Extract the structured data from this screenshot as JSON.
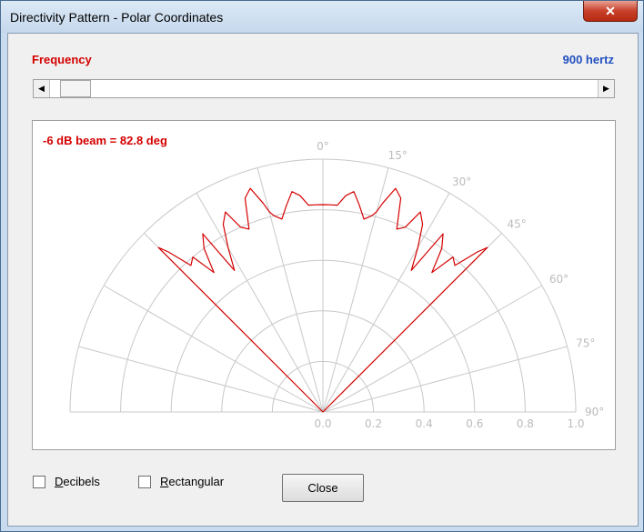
{
  "window": {
    "title": "Directivity Pattern - Polar Coordinates",
    "close_glyph": "✕"
  },
  "frequency": {
    "label": "Frequency",
    "value": "900 hertz"
  },
  "scrollbar": {
    "left_arrow": "◀",
    "right_arrow": "▶",
    "position_fraction": 0.02
  },
  "plot": {
    "beam_label": "-6 dB beam = 82.8 deg"
  },
  "options": {
    "decibels": {
      "mnemonic": "D",
      "rest": "ecibels",
      "checked": false
    },
    "rectangular": {
      "mnemonic": "R",
      "rest": "ectangular",
      "checked": false
    }
  },
  "buttons": {
    "close": "Close"
  },
  "chart_data": {
    "type": "polar",
    "angle_labels": [
      "0°",
      "15°",
      "30°",
      "45°",
      "60°",
      "75°",
      "90°"
    ],
    "radius_labels": [
      "0.0",
      "0.2",
      "0.4",
      "0.6",
      "0.8",
      "1.0"
    ],
    "rlim": [
      0,
      1
    ],
    "theta_range_deg": [
      -90,
      90
    ],
    "series": [
      {
        "color": "#d40000",
        "theta_deg": [
          -45,
          -44,
          -42,
          -40,
          -38,
          -36,
          -34,
          -32,
          -30,
          -28,
          -26,
          -24,
          -22,
          -20,
          -18,
          -16,
          -15,
          -14,
          -12,
          -10,
          -8,
          -6,
          -4,
          -2,
          0,
          2,
          4,
          6,
          8,
          10,
          12,
          14,
          15,
          16,
          18,
          20,
          22,
          24,
          26,
          28,
          30,
          32,
          34,
          36,
          38,
          40,
          42,
          44,
          45
        ],
        "r": [
          0.92,
          0.88,
          0.78,
          0.8,
          0.7,
          0.8,
          0.85,
          0.66,
          0.75,
          0.84,
          0.88,
          0.8,
          0.78,
          0.9,
          0.93,
          0.86,
          0.82,
          0.8,
          0.78,
          0.83,
          0.88,
          0.86,
          0.82,
          0.82,
          0.82,
          0.82,
          0.82,
          0.86,
          0.88,
          0.83,
          0.78,
          0.8,
          0.82,
          0.86,
          0.93,
          0.9,
          0.78,
          0.8,
          0.88,
          0.84,
          0.75,
          0.66,
          0.85,
          0.8,
          0.7,
          0.8,
          0.78,
          0.88,
          0.92
        ]
      }
    ],
    "grid": true
  }
}
